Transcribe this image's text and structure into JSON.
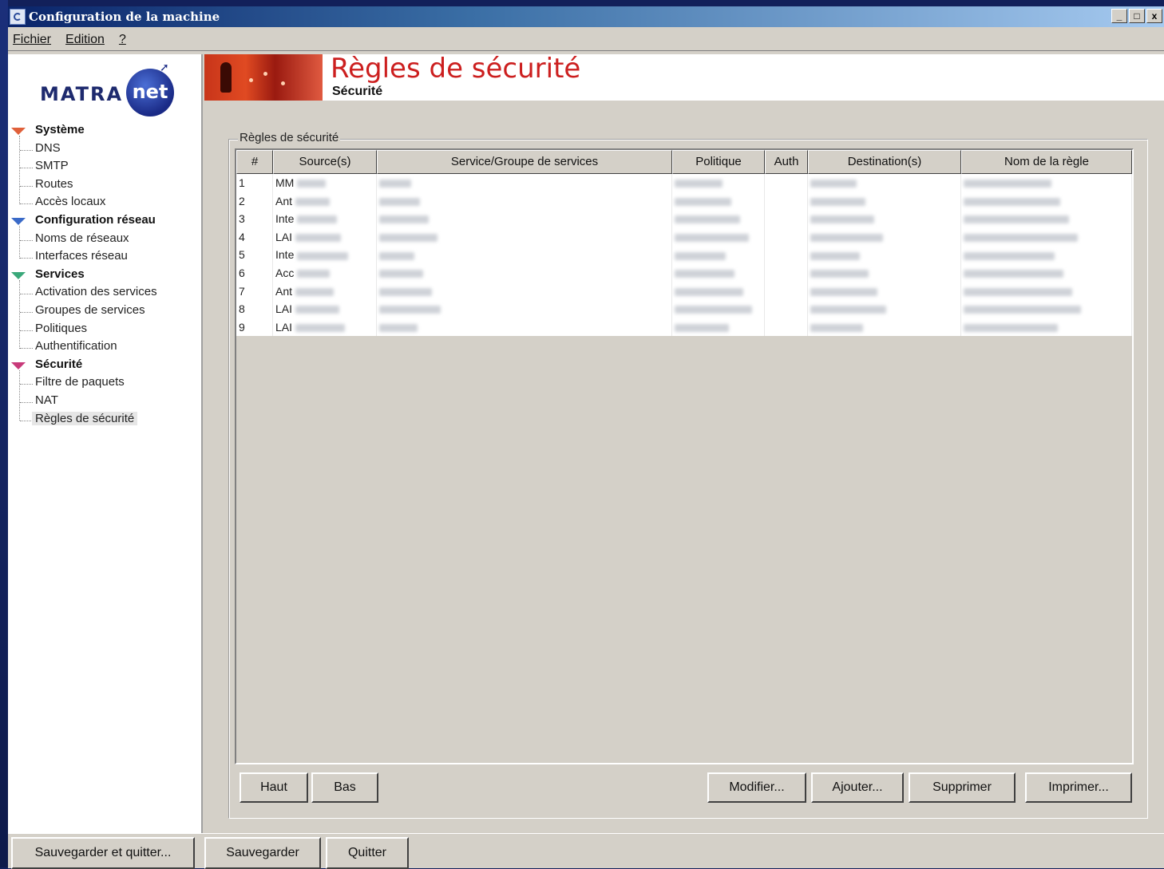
{
  "window": {
    "title": "Configuration de la machine",
    "controls": [
      "_",
      "□",
      "x"
    ]
  },
  "menu": [
    "Fichier",
    "Edition",
    "?"
  ],
  "logo": {
    "word": "MATRA",
    "badge": "net"
  },
  "sidebar": {
    "groups": [
      {
        "label": "Système",
        "color": "#e0603a",
        "items": [
          "DNS",
          "SMTP",
          "Routes",
          "Accès locaux"
        ]
      },
      {
        "label": "Configuration réseau",
        "color": "#3a6ac8",
        "items": [
          "Noms de réseaux",
          "Interfaces réseau"
        ]
      },
      {
        "label": "Services",
        "color": "#3aa87a",
        "items": [
          "Activation des services",
          "Groupes de services",
          "Politiques",
          "Authentification"
        ]
      },
      {
        "label": "Sécurité",
        "color": "#c83a7a",
        "items": [
          "Filtre de paquets",
          "NAT",
          "Règles de sécurité"
        ]
      }
    ],
    "selected": "Règles de sécurité"
  },
  "header": {
    "title": "Règles de sécurité",
    "subtitle": "Sécurité"
  },
  "rules": {
    "group_label": "Règles de sécurité",
    "columns": [
      "#",
      "Source(s)",
      "Service/Groupe de services",
      "Politique",
      "Auth",
      "Destination(s)",
      "Nom de la règle"
    ],
    "rows": [
      {
        "num": "1",
        "source": "MM"
      },
      {
        "num": "2",
        "source": "Ant"
      },
      {
        "num": "3",
        "source": "Inte"
      },
      {
        "num": "4",
        "source": "LAI"
      },
      {
        "num": "5",
        "source": "Inte"
      },
      {
        "num": "6",
        "source": "Acc"
      },
      {
        "num": "7",
        "source": "Ant"
      },
      {
        "num": "8",
        "source": "LAI"
      },
      {
        "num": "9",
        "source": "LAI"
      }
    ]
  },
  "buttons": {
    "up": "Haut",
    "down": "Bas",
    "modify": "Modifier...",
    "add": "Ajouter...",
    "delete": "Supprimer",
    "print": "Imprimer..."
  },
  "footer": {
    "save_quit": "Sauvegarder et quitter...",
    "save": "Sauvegarder",
    "quit": "Quitter"
  }
}
